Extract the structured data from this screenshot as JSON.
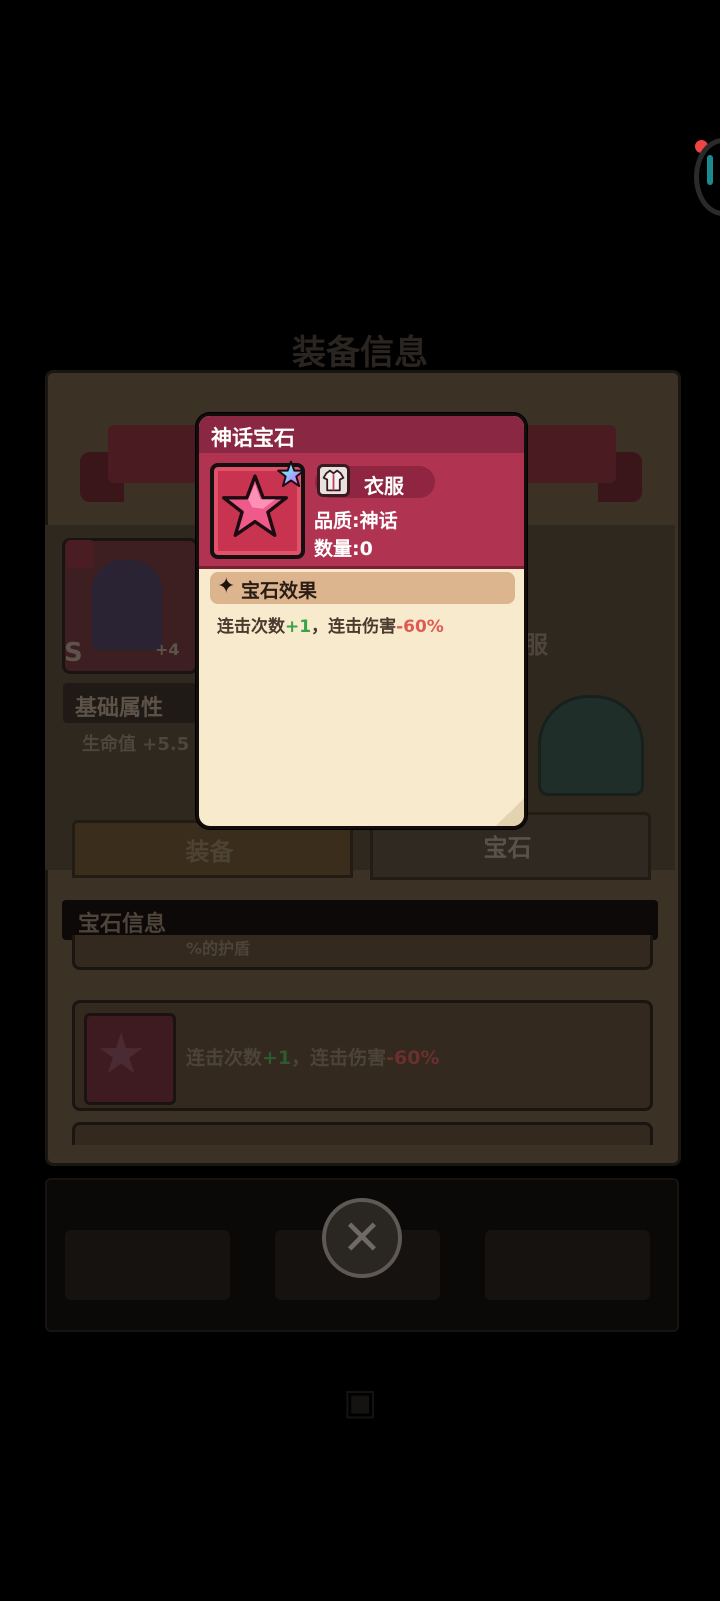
{
  "background": {
    "title": "装备信息",
    "item_level": "+4",
    "item_rank": "S",
    "base_attr_label": "基础属性",
    "hp_line": "生命值 +5.5",
    "item_type_label": "衣服",
    "tabs": [
      "装备",
      "宝石"
    ],
    "gem_info_label": "宝石信息",
    "gem_row_partial": "%的护盾",
    "gem_row_prefix": "连击次数",
    "gem_row_plus": "+1",
    "gem_row_mid": "，连击伤害",
    "gem_row_minus": "-60%"
  },
  "popup": {
    "title": "神话宝石",
    "type_label": "衣服",
    "quality": "品质:神话",
    "quantity": "数量:0",
    "effect_header": "宝石效果",
    "effect_prefix": "连击次数",
    "effect_plus": "+1",
    "effect_mid": "，连击伤害",
    "effect_minus": "-60%",
    "accent_color": "#b03451",
    "header_color": "#8a2843"
  },
  "icons": {
    "gem": "pink-star-icon",
    "rarity": "rainbow-star-icon",
    "type": "armor-icon",
    "effect": "four-point-star-icon",
    "close": "close-icon"
  }
}
